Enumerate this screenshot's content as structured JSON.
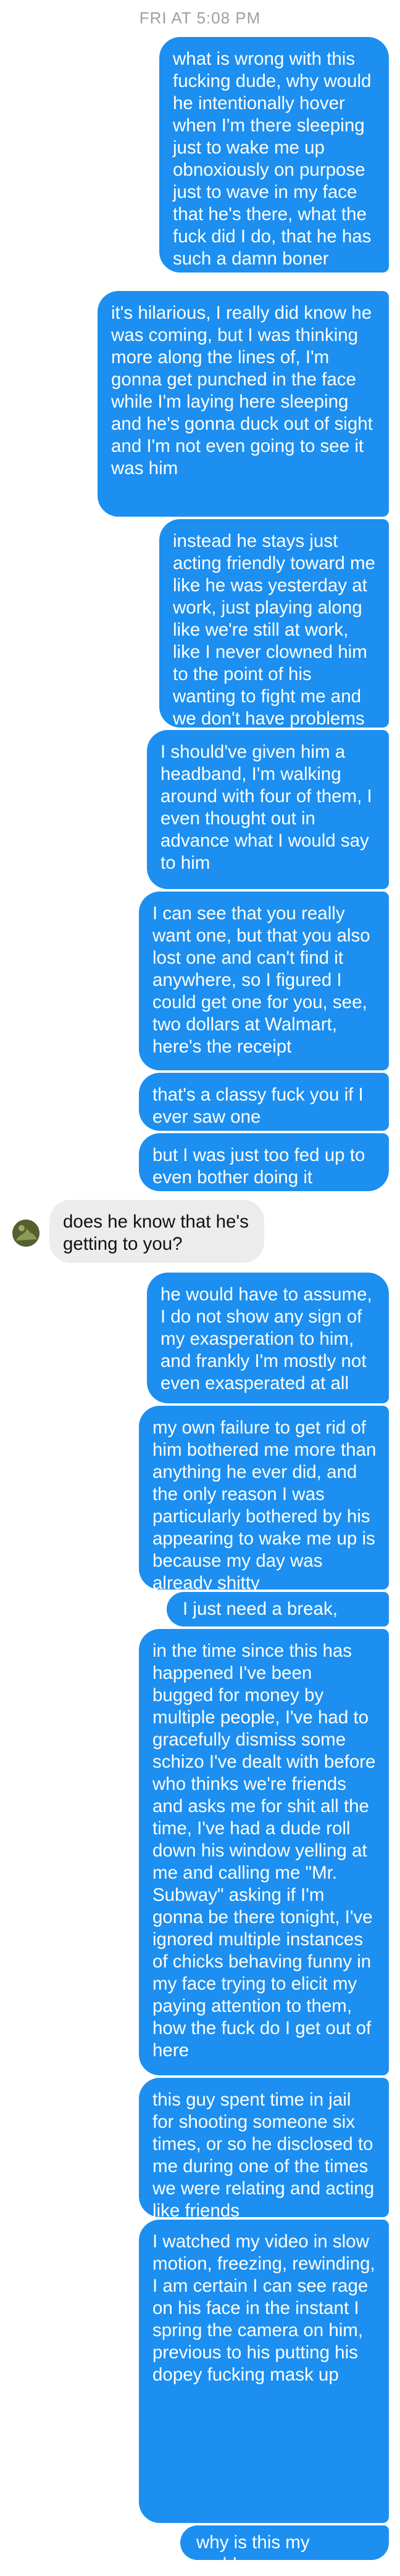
{
  "header": {
    "timestamp": "FRI AT 5:08 PM"
  },
  "colors": {
    "sent_bubble": "#1c8ff0",
    "received_bubble": "#ececec",
    "timestamp": "#9aa0a6"
  },
  "contact": {
    "avatar_icon": "avatar-icon"
  },
  "messages": [
    {
      "from": "me",
      "text": "what is wrong with this fucking dude, why would he intentionally hover when I'm there sleeping just to wake me up obnoxiously on purpose just to wave in my face that he's there, what the fuck did I do, that he has such a damn boner"
    },
    {
      "from": "me",
      "text": "it's hilarious, I really did know he was coming, but I was thinking more along the lines of, I'm gonna get punched in the face while I'm laying here sleeping and he's gonna duck out of sight and I'm not even going to see it was him"
    },
    {
      "from": "me",
      "text": "instead he stays just acting friendly toward me like he was yesterday at work, just playing along like we're still at work, like I never clowned him to the point of his wanting to fight me and we don't have problems"
    },
    {
      "from": "me",
      "text": "I should've given him a headband, I'm walking around with four of them, I even thought out in advance what I would say to him"
    },
    {
      "from": "me",
      "text": "I can see that you really want one, but that you also lost one and can't find it anywhere, so I figured I could get one for you, see, two dollars at Walmart, here's the receipt"
    },
    {
      "from": "me",
      "text": "that's a classy fuck you if I ever saw one"
    },
    {
      "from": "me",
      "text": "but I was just too fed up to even bother doing it"
    },
    {
      "from": "them",
      "text": "does he know that he's getting to you?"
    },
    {
      "from": "me",
      "text": "he would have to assume, I do not show any sign of my exasperation to him, and frankly I'm mostly not even exasperated at all"
    },
    {
      "from": "me",
      "text": "my own failure to get rid of him bothered me more than anything he ever did, and the only reason I was particularly bothered by his appearing to wake me up is because my day was already shitty"
    },
    {
      "from": "me",
      "text": "I just need a break, man"
    },
    {
      "from": "me",
      "text": "in the time since this has happened I've been bugged for money by multiple people, I've had to gracefully dismiss some schizo I've dealt with before who thinks we're friends and asks me for shit all the time, I've had a dude roll down his window yelling at me and calling me \"Mr. Subway\" asking if I'm gonna be there tonight, I've ignored multiple instances of chicks behaving funny in my face trying to elicit my paying attention to them, how the fuck do I get out of here"
    },
    {
      "from": "me",
      "text": "this guy spent time in jail for shooting someone six times, or so he disclosed to me during one of the times we were relating and acting like friends"
    },
    {
      "from": "me",
      "text": "I watched my video in slow motion, freezing, rewinding, I am certain I can see rage on his face in the instant I spring the camera on him, previous to his putting his dopey fucking mask up"
    },
    {
      "from": "me",
      "text": "why is this my problem"
    }
  ]
}
